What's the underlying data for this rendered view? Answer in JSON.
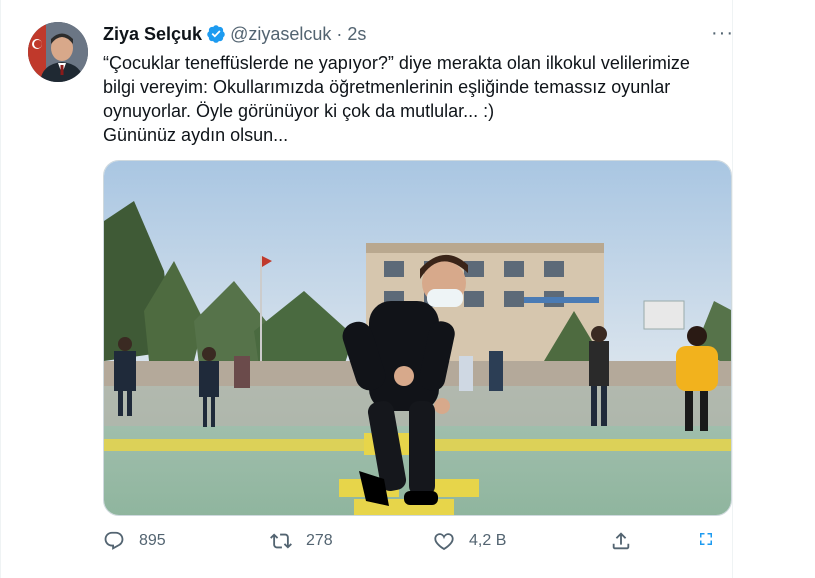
{
  "author": {
    "name": "Ziya Selçuk",
    "handle": "@ziyaselcuk",
    "separator": "·",
    "time": "2s"
  },
  "more_label": "···",
  "tweet": {
    "lines": [
      "“Çocuklar teneffüslerde ne yapıyor?” diye merakta olan ilkokul velilerimize",
      "bilgi vereyim: Okullarımızda öğretmenlerinin eşliğinde temassız oyunlar",
      "oynuyorlar. Öyle görünüyor ki çok da mutlular... :)",
      "Gününüz aydın olsun..."
    ]
  },
  "actions": {
    "reply": {
      "icon": "reply-icon",
      "count": "895"
    },
    "retweet": {
      "icon": "retweet-icon",
      "count": "278"
    },
    "like": {
      "icon": "heart-icon",
      "count": "4,2 B"
    },
    "share": {
      "icon": "share-icon"
    },
    "expand": {
      "icon": "expand-icon"
    }
  },
  "colors": {
    "verified": "#1d9bf0",
    "secondary_text": "#536471",
    "primary_text": "#0f1419"
  }
}
